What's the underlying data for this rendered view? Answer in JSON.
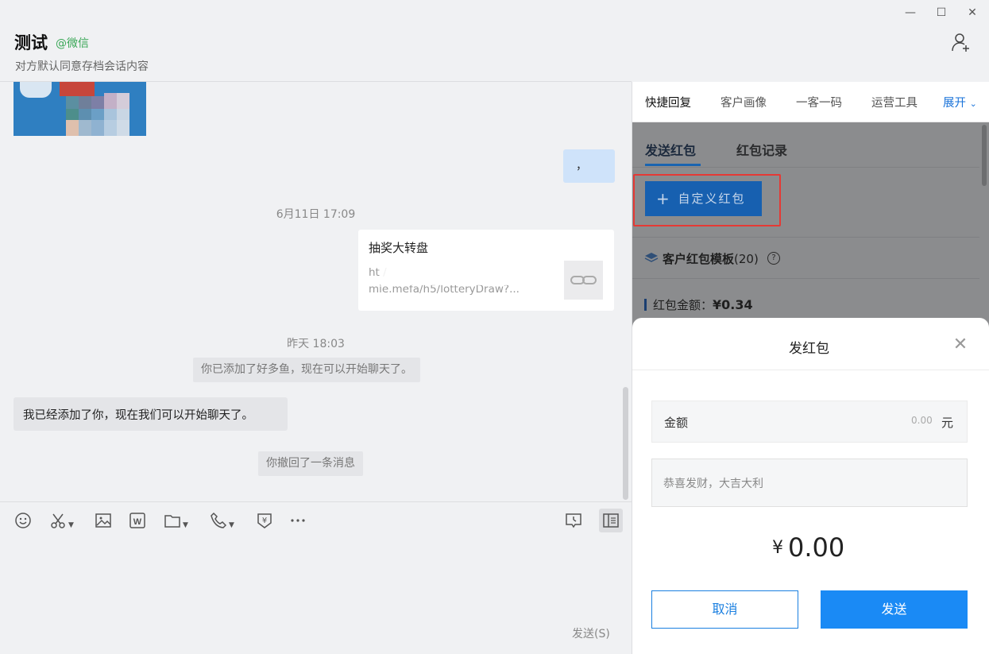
{
  "window": {
    "minimize": "—",
    "maximize": "☐",
    "close": "✕"
  },
  "header": {
    "title": "测试",
    "source": "@微信",
    "subtitle": "对方默认同意存档会话内容"
  },
  "chat": {
    "blue_bubble_text": "，",
    "timestamp1": "6月11日 17:09",
    "link_card": {
      "title": "抽奖大转盘",
      "url_line1": "ht                                       /",
      "url_line2": "mie.mefa/h5/lotteryDraw?..."
    },
    "timestamp2": "昨天 18:03",
    "system_added": "你已添加了好多鱼，现在可以开始聊天了。",
    "left_message": "我已经添加了你，现在我们可以开始聊天了。",
    "system_recall": "你撤回了一条消息"
  },
  "toolbar": {
    "send_hint": "发送(S)"
  },
  "panel": {
    "tabs": [
      "快捷回复",
      "客户画像",
      "一客一码",
      "运营工具"
    ],
    "expand_label": "展开",
    "subtabs": [
      "发送红包",
      "红包记录"
    ],
    "custom_button": "自定义红包",
    "template_title": "客户红包模板",
    "template_count": "(20)",
    "amount_label": "红包金额：",
    "amount_value": "¥0.34"
  },
  "modal": {
    "title": "发红包",
    "amount_label": "金额",
    "amount_placeholder": "0.00",
    "amount_unit": "元",
    "wish_placeholder": "恭喜发财，大吉大利",
    "total_symbol": "¥",
    "total_value": "0.00",
    "cancel_label": "取消",
    "send_label": "发送"
  }
}
